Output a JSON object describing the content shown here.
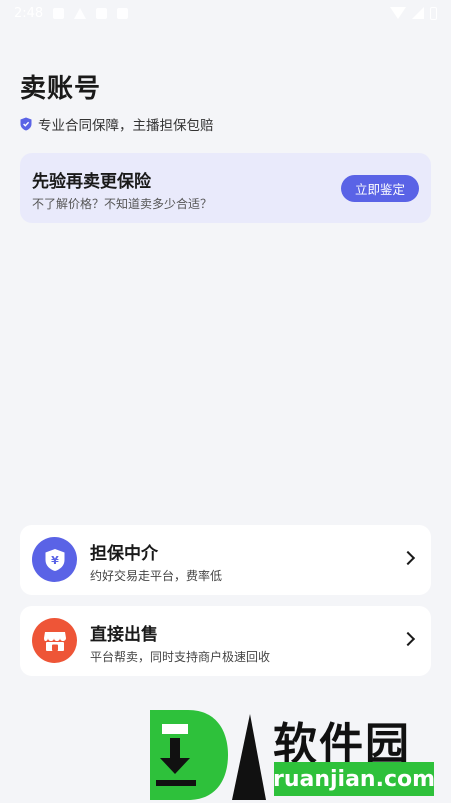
{
  "status_bar": {
    "time": "2:48"
  },
  "header": {
    "title": "卖账号",
    "subtitle": "专业合同保障，主播担保包赔",
    "subtitle_icon": "shield-check-icon"
  },
  "verify_card": {
    "title": "先验再卖更保险",
    "description": "不了解价格？不知道卖多少合适？",
    "button_label": "立即鉴定"
  },
  "options": [
    {
      "title": "担保中介",
      "description": "约好交易走平台，费率低",
      "icon": "yuan-shield-icon",
      "icon_color": "#5a63e6"
    },
    {
      "title": "直接出售",
      "description": "平台帮卖，同时支持商户极速回收",
      "icon": "shop-icon",
      "icon_color": "#ee5537"
    }
  ],
  "watermark": {
    "brand": "软件园",
    "url": "ruanjian.com"
  },
  "colors": {
    "accent": "#5a63e6",
    "card_highlight": "#e9eafb",
    "sell_icon": "#ee5537",
    "background": "#f4f5f8"
  }
}
